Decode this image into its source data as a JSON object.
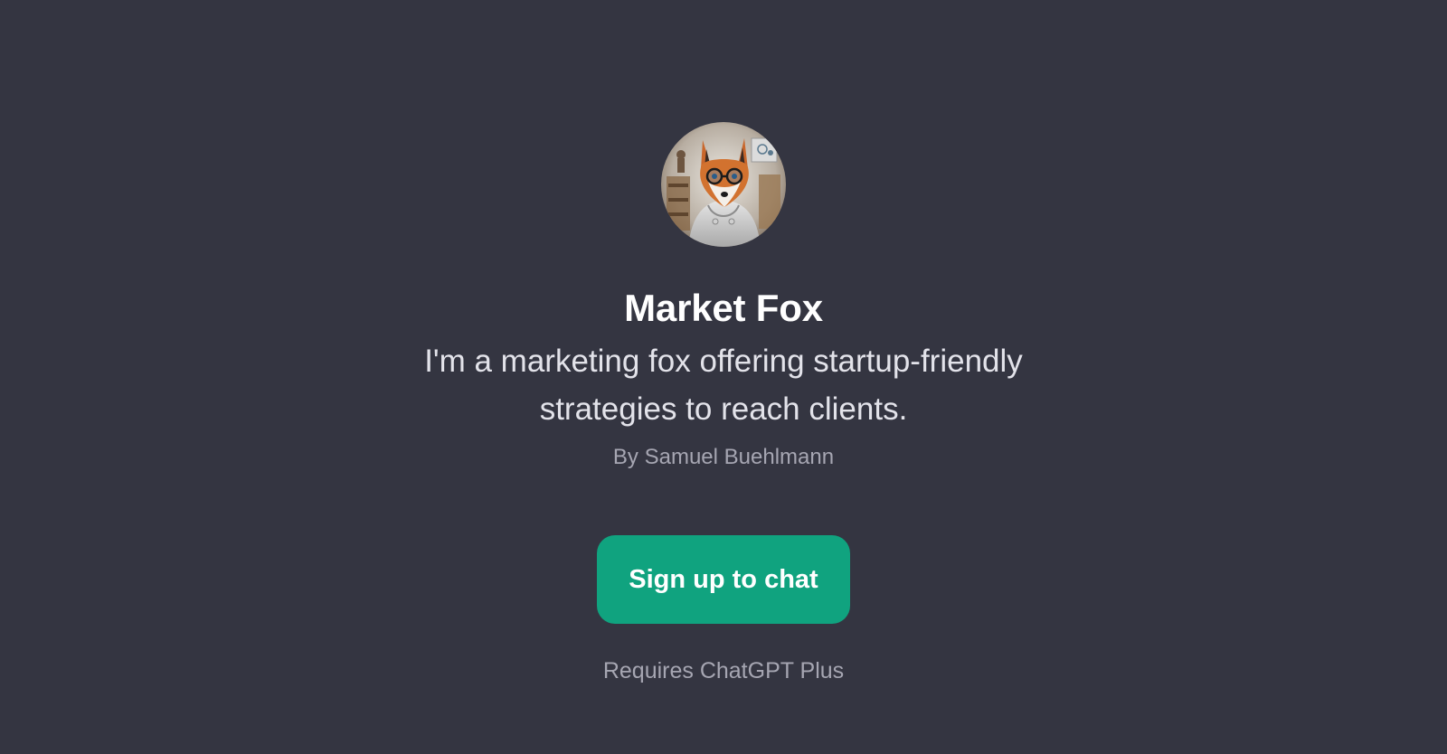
{
  "gpt": {
    "name": "Market Fox",
    "description": "I'm a marketing fox offering startup-friendly strategies to reach clients.",
    "author": "By Samuel Buehlmann",
    "avatar_icon": "fox-avatar-icon"
  },
  "actions": {
    "signup_label": "Sign up to chat"
  },
  "footer": {
    "requirement": "Requires ChatGPT Plus"
  },
  "colors": {
    "background": "#343541",
    "accent": "#10a37f",
    "title": "#ffffff",
    "muted": "#a6a6b2"
  }
}
